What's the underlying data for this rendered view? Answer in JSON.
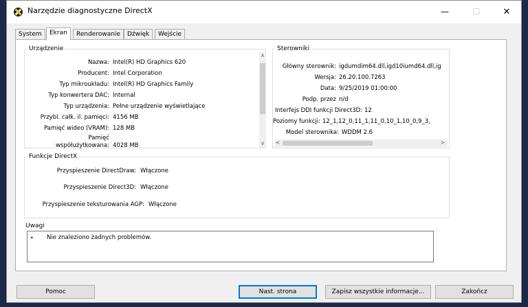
{
  "window": {
    "title": "Narzędzie diagnostyczne DirectX",
    "min": "—",
    "max": "☐",
    "close": "✕"
  },
  "tabs": [
    {
      "label": "System"
    },
    {
      "label": "Ekran"
    },
    {
      "label": "Renderowanie"
    },
    {
      "label": "Dźwięk"
    },
    {
      "label": "Wejście"
    }
  ],
  "active_tab": "Ekran",
  "device": {
    "title": "Urządzenie",
    "rows": [
      {
        "label": "Nazwa:",
        "value": "Intel(R) HD Graphics 620"
      },
      {
        "label": "Producent:",
        "value": "Intel Corporation"
      },
      {
        "label": "Typ mikroukładu:",
        "value": "Intel(R) HD Graphics Family"
      },
      {
        "label": "Typ konwertera DAC:",
        "value": "Internal"
      },
      {
        "label": "Typ urządzenia:",
        "value": "Pełne urządzenie wyświetlające"
      },
      {
        "label": "Przybl. całk. il. pamięci:",
        "value": "4156 MB"
      },
      {
        "label": "Pamięć wideo (VRAM):",
        "value": "128 MB"
      },
      {
        "label": "Pamięć",
        "value": ""
      },
      {
        "label": "współużytkowana:",
        "value": "4028 MB"
      }
    ]
  },
  "drivers": {
    "title": "Sterowniki",
    "rows": [
      {
        "label": "Główny sterownik:",
        "value": "igdumdim64.dll,igd10iumd64.dll,ig"
      },
      {
        "label": "Wersja:",
        "value": "26.20.100.7263"
      },
      {
        "label": "Data:",
        "value": "9/25/2019 01:00:00"
      },
      {
        "label": "Podp. przez",
        "value": "n/d"
      },
      {
        "label": "Interfejs DDI funkcji Direct3D:",
        "value": "12"
      },
      {
        "label": "Poziomy funkcji:",
        "value": "12_1,12_0,11_1,11_0,10_1,10_0,9_3,"
      },
      {
        "label": "Model sterownika:",
        "value": "WDDM 2.6"
      }
    ]
  },
  "features": {
    "title": "Funkcje DirectX",
    "rows": [
      {
        "label": "Przyspieszenie DirectDraw:",
        "value": "Włączone"
      },
      {
        "label": "Przyspieszenie Direct3D:",
        "value": "Włączone"
      },
      {
        "label": "Przyspieszenie teksturowania AGP:",
        "value": "Włączone"
      }
    ]
  },
  "notes": {
    "title": "Uwagi",
    "bullet": "•",
    "text": "Nie znaleziono żadnych problemów."
  },
  "scroll": {
    "up": "∧",
    "down": "∨",
    "left": "<",
    "right": ">"
  },
  "buttons": {
    "help": "Pomoc",
    "next": "Nast. strona",
    "save_all": "Zapisz wszystkie informacje...",
    "exit": "Zakończ"
  }
}
